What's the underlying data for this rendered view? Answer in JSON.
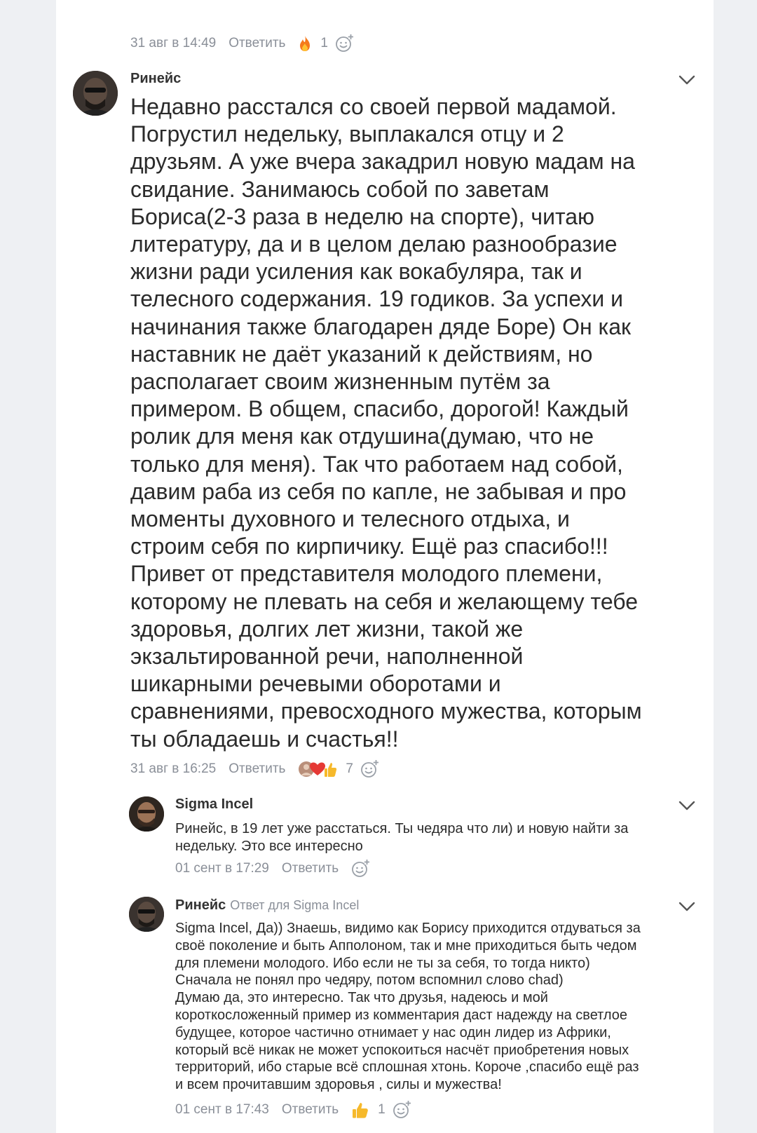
{
  "top_meta": {
    "date": "31 авг в 14:49",
    "reply_label": "Ответить",
    "reaction_icon": "fire-icon",
    "reaction_count": "1"
  },
  "main_comment": {
    "author": "Ринейс",
    "text": "Недавно расстался со своей первой мадамой.\nПогрустил недельку, выплакался отцу и 2\nдрузьям. А уже вчера закадрил новую мадам на\nсвидание. Занимаюсь собой по заветам\nБориса(2-3 раза в неделю на спорте), читаю\nлитературу, да и в целом делаю разнообразие\nжизни ради усиления как вокабуляра, так и\nтелесного содержания. 19 годиков. За успехи и\nначинания также благодарен дяде Боре) Он как\nнаставник не даёт указаний к действиям, но\nрасполагает своим жизненным путём за\nпримером. В общем, спасибо, дорогой! Каждый\nролик для меня как отдушина(думаю, что не\nтолько для меня). Так что работаем над собой,\nдавим раба из себя по капле, не забывая и про\nмоменты духовного и телесного отдыха, и\nстроим себя по кирпичику. Ещё раз спасибо!!!\nПривет от представителя молодого племени,\nкоторому не плевать на себя и желающему тебе\nздоровья, долгих лет жизни, такой же\nэкзальтированной речи, наполненной\nшикарными речевыми оборотами и\nсравнениями, превосходного мужества, которым\nты обладаешь и счастья!!",
    "date": "31 авг в 16:25",
    "reply_label": "Ответить",
    "reaction_count": "7"
  },
  "reply1": {
    "author": "Sigma Incel",
    "text": "Ринейс, в 19 лет уже расстаться. Ты чедяра что ли) и новую найти за\nнедельку. Это все интересно",
    "date": "01 сент в 17:29",
    "reply_label": "Ответить"
  },
  "reply2": {
    "author": "Ринейс",
    "reply_to": "Ответ для Sigma Incel",
    "text": "Sigma Incel, Да)) Знаешь, видимо как Борису приходится отдуваться за\nсвоё поколение и быть Апполоном, так и мне приходиться быть чедом\nдля племени молодого. Ибо если не ты за себя, то тогда никто)\nСначала не понял про чедяру, потом вспомнил слово chad)\nДумаю да, это интересно. Так что друзья, надеюсь и мой\nкороткосложенный пример из комментария даст надежду на светлое\nбудущее, которое частично отнимает у нас один лидер из Африки,\nкоторый всё никак не может успокоиться насчёт приобретения новых\nтерриторий, ибо старые всё сплошная хтонь. Короче ,спасибо ещё раз\nи всем прочитавшим здоровья , силы и мужества!",
    "date": "01 сент в 17:43",
    "reply_label": "Ответить",
    "reaction_icon": "thumbs-up-icon",
    "reaction_count": "1"
  }
}
